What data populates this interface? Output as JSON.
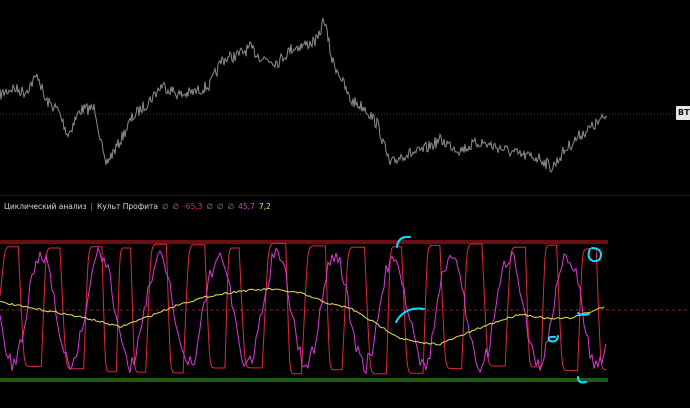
{
  "price_pane": {
    "last_price_tag": "BT",
    "colors": {
      "price_line": "#8c8c8c",
      "last_price_line": "#3a3a3a"
    }
  },
  "indicator": {
    "name": "Циклический анализ",
    "separator": "|",
    "author": "Культ Профита",
    "values": [
      {
        "text": "∅",
        "color": "#8a8a8a"
      },
      {
        "text": "∅",
        "color": "#8a8a8a"
      },
      {
        "text": "-65,3",
        "color": "#e0283c"
      },
      {
        "text": "∅",
        "color": "#8a8a8a"
      },
      {
        "text": "∅",
        "color": "#8a8a8a"
      },
      {
        "text": "∅",
        "color": "#8a8a8a"
      },
      {
        "text": "45,7",
        "color": "#d63ad6"
      },
      {
        "text": "7,2",
        "color": "#f0e050"
      }
    ],
    "colors": {
      "cycle_line": "#e0283c",
      "fast_line": "#d63ad6",
      "slow_line": "#e8e050",
      "upper_band": "#6b0f14",
      "lower_band": "#1f5a12",
      "mid_line": "#7a2a2a",
      "annotation": "#00e5ff"
    }
  }
}
